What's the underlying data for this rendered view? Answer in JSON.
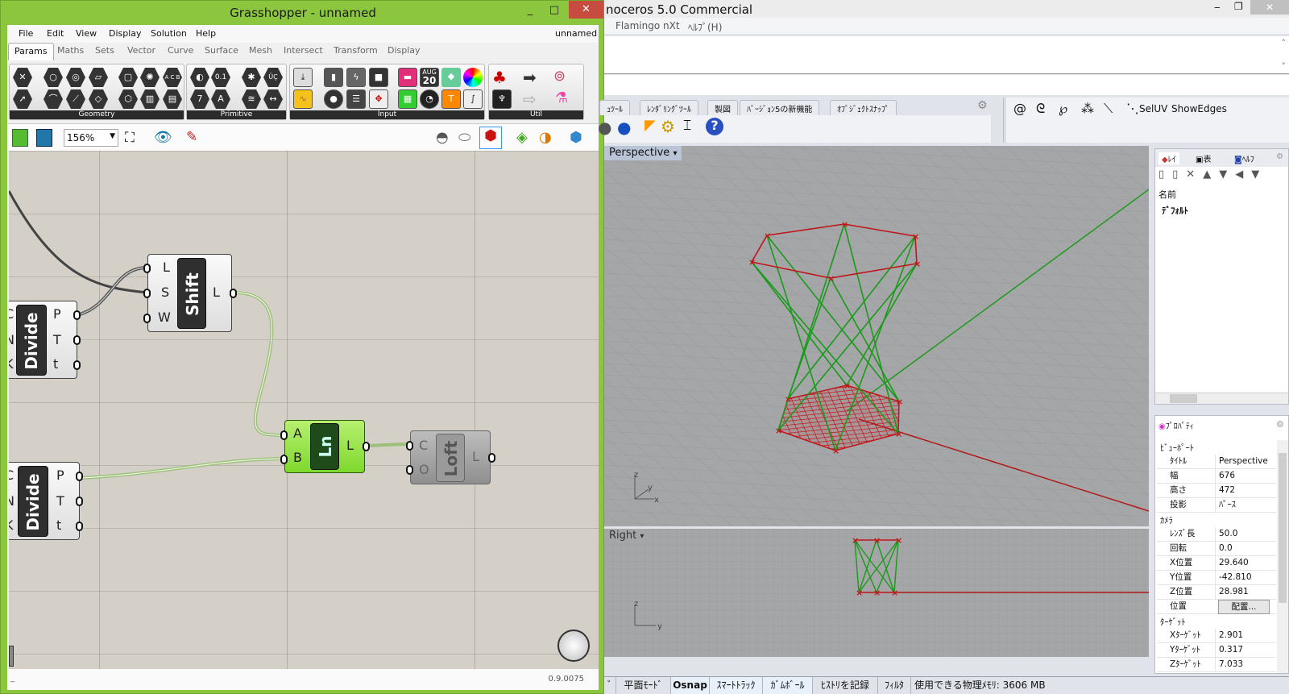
{
  "grasshopper": {
    "title": "Grasshopper - unnamed",
    "window_buttons": {
      "minimize": "_",
      "maximize": "□",
      "close": "✕"
    },
    "menu": [
      "File",
      "Edit",
      "View",
      "Display",
      "Solution",
      "Help"
    ],
    "document_name": "unnamed",
    "tabs": [
      "Params",
      "Maths",
      "Sets",
      "Vector",
      "Curve",
      "Surface",
      "Mesh",
      "Intersect",
      "Transform",
      "Display"
    ],
    "active_tab": "Params",
    "ribbon_groups": [
      "Geometry",
      "Primitive",
      "Input",
      "Util"
    ],
    "ribbon_icon_text": {
      "abc": "A C B",
      "num": "0.1",
      "seven": "7",
      "letter": "A",
      "uc": "ÜÇ",
      "calendar_month": "AUG",
      "calendar_day": "20"
    },
    "zoom": "156%",
    "version": "0.9.0075",
    "status_left": "_",
    "components": [
      {
        "name": "Divide",
        "inputs": [
          "C",
          "N",
          "K"
        ],
        "outputs": [
          "P",
          "T",
          "t"
        ]
      },
      {
        "name": "Shift",
        "inputs": [
          "L",
          "S",
          "W"
        ],
        "outputs": [
          "L"
        ]
      },
      {
        "name": "Divide",
        "inputs": [
          "C",
          "N",
          "K"
        ],
        "outputs": [
          "P",
          "T",
          "t"
        ]
      },
      {
        "name": "Ln",
        "inputs": [
          "A",
          "B"
        ],
        "outputs": [
          "L"
        ]
      },
      {
        "name": "Loft",
        "inputs": [
          "C",
          "O"
        ],
        "outputs": [
          "L"
        ]
      }
    ]
  },
  "rhino": {
    "title": "noceros 5.0 Commercial",
    "menu": [
      "Flamingo nXt",
      "ﾍﾙﾌﾟ(H)"
    ],
    "toolbar_tabs": [
      "ｭﾂｰﾙ",
      "ﾚﾝﾀﾞﾘﾝｸﾞﾂｰﾙ",
      "製図",
      "ﾊﾞｰｼﾞｮﾝ5の新機能",
      "ｵﾌﾞｼﾞｪｸﾄｽﾅｯﾌﾟ"
    ],
    "toolbar2": [
      "SelUV",
      "ShowEdges"
    ],
    "viewports": [
      {
        "name": "Perspective"
      },
      {
        "name": "Right"
      }
    ],
    "axes": {
      "x": "x",
      "y": "y",
      "z": "z"
    },
    "layers_panel": {
      "tabs": [
        "ﾚｲ",
        "表",
        "ﾍﾙﾌ"
      ],
      "header": "名前",
      "layers": [
        "ﾃﾞﾌｫﾙﾄ"
      ]
    },
    "properties_panel": {
      "tab": "ﾌﾟﾛﾊﾟﾃｨ",
      "sections": [
        {
          "title": "ﾋﾞｭｰﾎﾟｰﾄ",
          "rows": [
            [
              "ﾀｲﾄﾙ",
              "Perspective"
            ],
            [
              "幅",
              "676"
            ],
            [
              "高さ",
              "472"
            ],
            [
              "投影",
              "ﾊﾟｰｽ"
            ]
          ]
        },
        {
          "title": "ｶﾒﾗ",
          "rows": [
            [
              "ﾚﾝｽﾞ長",
              "50.0"
            ],
            [
              "回転",
              "0.0"
            ],
            [
              "X位置",
              "29.640"
            ],
            [
              "Y位置",
              "-42.810"
            ],
            [
              "Z位置",
              "28.981"
            ],
            [
              "位置",
              "配置..."
            ]
          ]
        },
        {
          "title": "ﾀｰｹﾞｯﾄ",
          "rows": [
            [
              "Xﾀｰｹﾞｯﾄ",
              "2.901"
            ],
            [
              "Yﾀｰｹﾞｯﾄ",
              "0.317"
            ],
            [
              "Zﾀｰｹﾞｯﾄ",
              "7.033"
            ]
          ]
        }
      ]
    },
    "status_bar": [
      "ﾞ",
      "平面ﾓｰﾄﾞ",
      "Osnap",
      "ｽﾏｰﾄﾄﾗｯｸ",
      "ｶﾞﾑﾎﾞｰﾙ",
      "ﾋｽﾄﾘを記録",
      "ﾌｨﾙﾀ",
      "使用できる物理ﾒﾓﾘ: 3606 MB"
    ]
  },
  "colors": {
    "gh_frame": "#8cc63e",
    "canvas": "#d4d0c8",
    "ln_green": "#8fe03c",
    "wire_green": "#7ec83a",
    "curve_red": "#c0161a",
    "line_green": "#1a9a1a"
  }
}
